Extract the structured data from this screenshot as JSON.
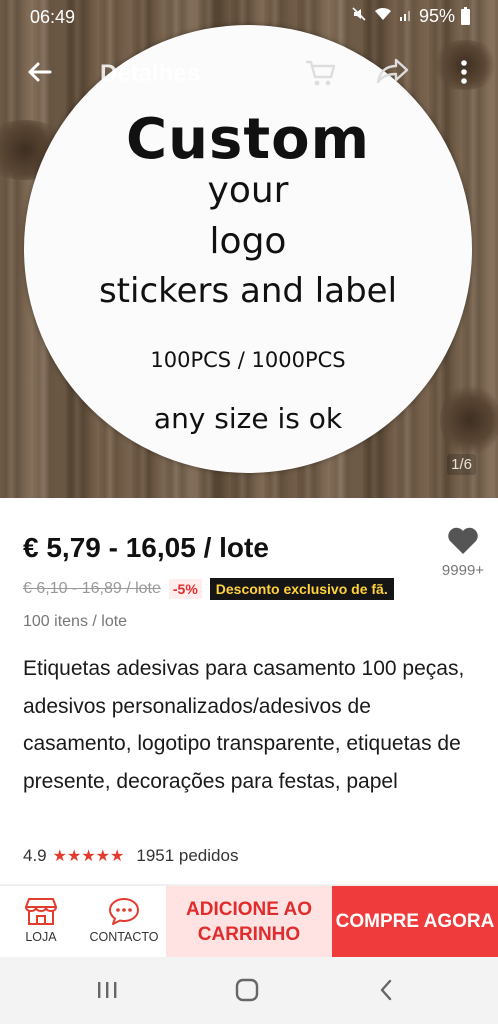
{
  "status_bar": {
    "time": "06:49",
    "battery": "95%"
  },
  "app_bar": {
    "title": "Detalhes"
  },
  "gallery": {
    "sticker_lines": [
      "Custom",
      "your",
      "logo",
      "stickers and label",
      "100PCS / 1000PCS",
      "any size is ok"
    ],
    "counter": "1/6"
  },
  "product": {
    "price": "€ 5,79 - 16,05 / lote",
    "old_price": "€ 6,10 - 16,89 / lote",
    "discount": "-5%",
    "promo_badge": "Desconto exclusivo de fã.",
    "wishlist_count": "9999+",
    "per_lot": "100 itens / lote",
    "title": "Etiquetas adesivas para casamento 100 peças, adesivos personalizados/adesivos de casamento, logotipo transparente, etiquetas de presente, decorações para festas, papel",
    "rating": "4.9",
    "stars": "★★★★★",
    "orders": "1951 pedidos"
  },
  "actions": {
    "store_label": "LOJA",
    "contact_label": "CONTACTO",
    "add_to_cart_label": "ADICIONE AO CARRINHO",
    "buy_now_label": "COMPRE AGORA"
  },
  "colors": {
    "accent": "#ef3b3b",
    "accent_light": "#ffe2e2",
    "promo_bg": "#151515",
    "promo_text": "#ffd23c"
  }
}
